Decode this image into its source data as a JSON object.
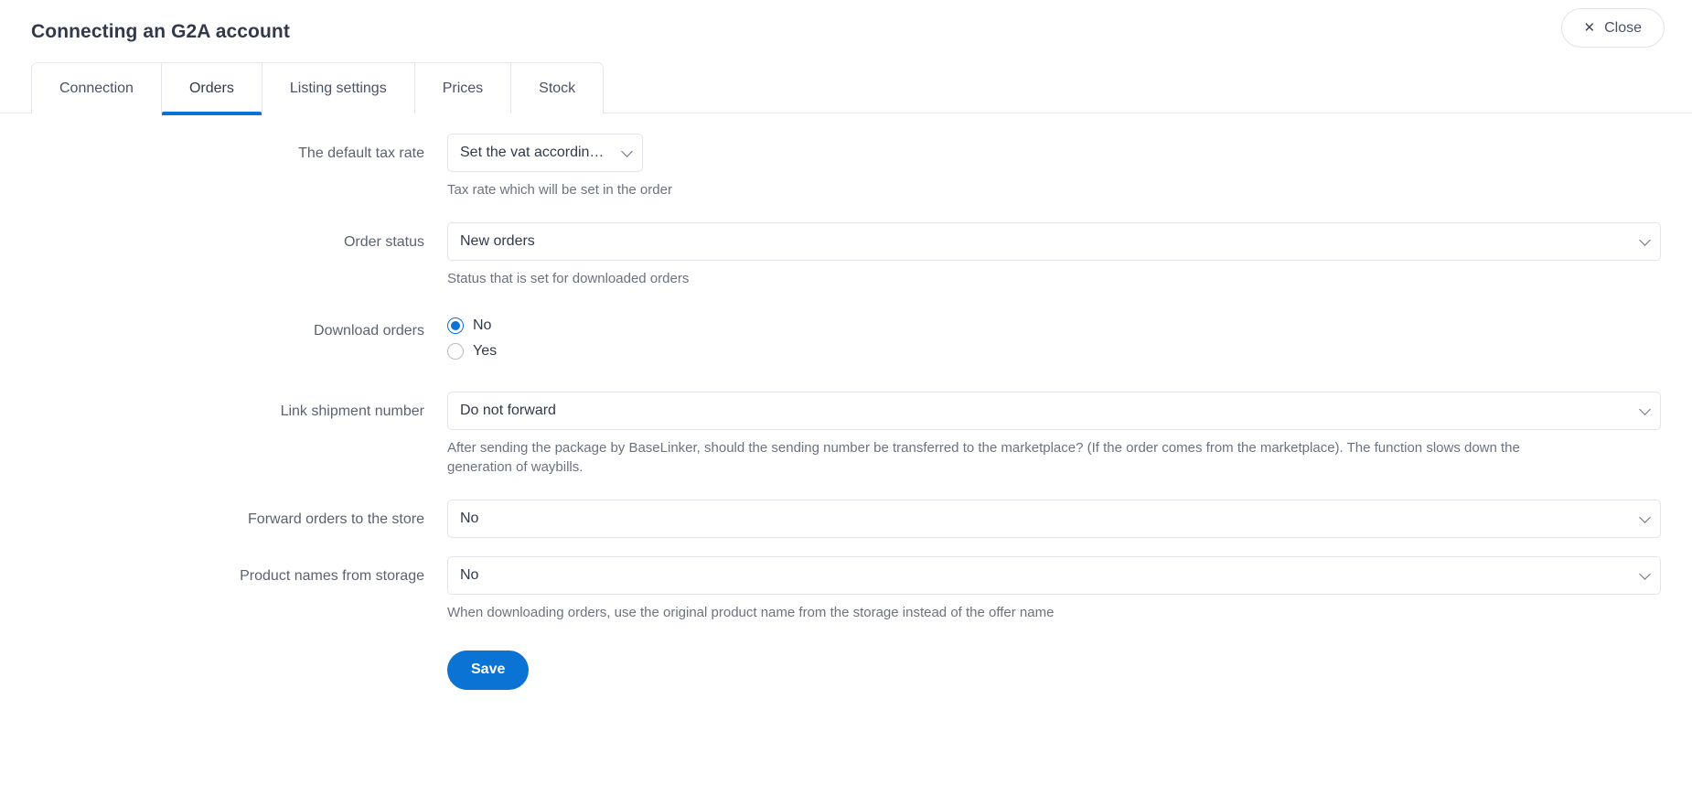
{
  "header": {
    "title": "Connecting an G2A account",
    "close_label": "Close",
    "close_icon": "close-icon"
  },
  "tabs": [
    {
      "label": "Connection",
      "active": false
    },
    {
      "label": "Orders",
      "active": true
    },
    {
      "label": "Listing settings",
      "active": false
    },
    {
      "label": "Prices",
      "active": false
    },
    {
      "label": "Stock",
      "active": false
    }
  ],
  "form": {
    "tax_rate": {
      "label": "The default tax rate",
      "value": "Set the vat according to the",
      "helper": "Tax rate which will be set in the order"
    },
    "order_status": {
      "label": "Order status",
      "value": "New orders",
      "helper": "Status that is set for downloaded orders"
    },
    "download_orders": {
      "label": "Download orders",
      "options": [
        {
          "label": "No",
          "selected": true
        },
        {
          "label": "Yes",
          "selected": false
        }
      ]
    },
    "link_shipment": {
      "label": "Link shipment number",
      "value": "Do not forward",
      "helper": "After sending the package by BaseLinker, should the sending number be transferred to the marketplace? (If the order comes from the marketplace). The function slows down the generation of waybills."
    },
    "forward_orders": {
      "label": "Forward orders to the store",
      "value": "No"
    },
    "product_names": {
      "label": "Product names from storage",
      "value": "No",
      "helper": "When downloading orders, use the original product name from the storage instead of the offer name"
    },
    "save_label": "Save"
  },
  "colors": {
    "accent": "#0b73d4",
    "text": "#31394a",
    "muted": "#6b7280",
    "border": "#e4e7eb"
  }
}
